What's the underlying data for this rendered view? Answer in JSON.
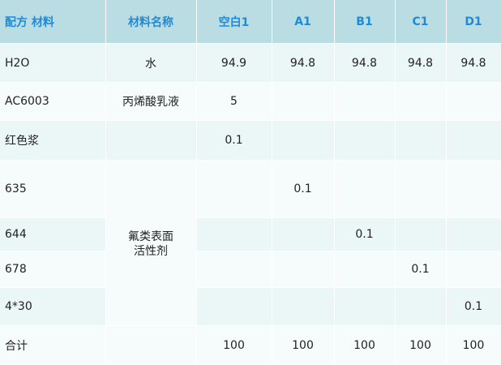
{
  "table": {
    "headers": [
      "配方 材料",
      "材料名称",
      "空白1",
      "A1",
      "B1",
      "C1",
      "D1"
    ],
    "rows": [
      {
        "material": "H2O",
        "name": "水",
        "values": [
          "94.9",
          "94.8",
          "94.8",
          "94.8",
          "94.8"
        ]
      },
      {
        "material": "AC6003",
        "name": "丙烯酸乳液",
        "values": [
          "5",
          "",
          "",
          "",
          ""
        ]
      },
      {
        "material": "红色浆",
        "name": "",
        "values": [
          "0.1",
          "",
          "",
          "",
          ""
        ]
      },
      {
        "material": "635",
        "name": "",
        "values": [
          "",
          "0.1",
          "",
          "",
          ""
        ]
      },
      {
        "material": "644",
        "name": "",
        "values": [
          "",
          "",
          "0.1",
          "",
          ""
        ]
      },
      {
        "material": "678",
        "name": "",
        "values": [
          "",
          "",
          "",
          "0.1",
          ""
        ]
      },
      {
        "material": "4*30",
        "name": "",
        "values": [
          "",
          "",
          "",
          "",
          "0.1"
        ]
      },
      {
        "material": "合计",
        "name": "",
        "values": [
          "100",
          "100",
          "100",
          "100",
          "100"
        ]
      }
    ],
    "merged_name": {
      "line1": "氟类表面",
      "line2": "活性剂"
    }
  },
  "colors": {
    "header_bg": "#b9dde3",
    "header_text": "#1f8ad6",
    "row_alt_bg": "#ebf6f7",
    "row_plain_bg": "#f6fbfc"
  }
}
